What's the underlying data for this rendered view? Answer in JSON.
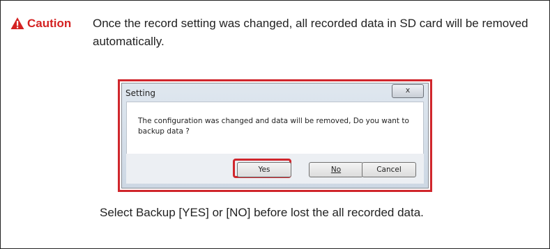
{
  "caution": {
    "label": "Caution",
    "text": "Once the record setting was changed, all recorded data in SD card will be removed automatically.",
    "icon": "warning-triangle-icon",
    "color": "#d42222"
  },
  "dialog": {
    "title": "Setting",
    "close_glyph": "x",
    "message": "The configuration was changed and data will be removed, Do you want to backup data ?",
    "buttons": {
      "yes": "Yes",
      "no": "No",
      "cancel": "Cancel"
    },
    "highlight_color": "#d0262c"
  },
  "instruction": "Select Backup [YES] or [NO] before lost the all recorded data."
}
